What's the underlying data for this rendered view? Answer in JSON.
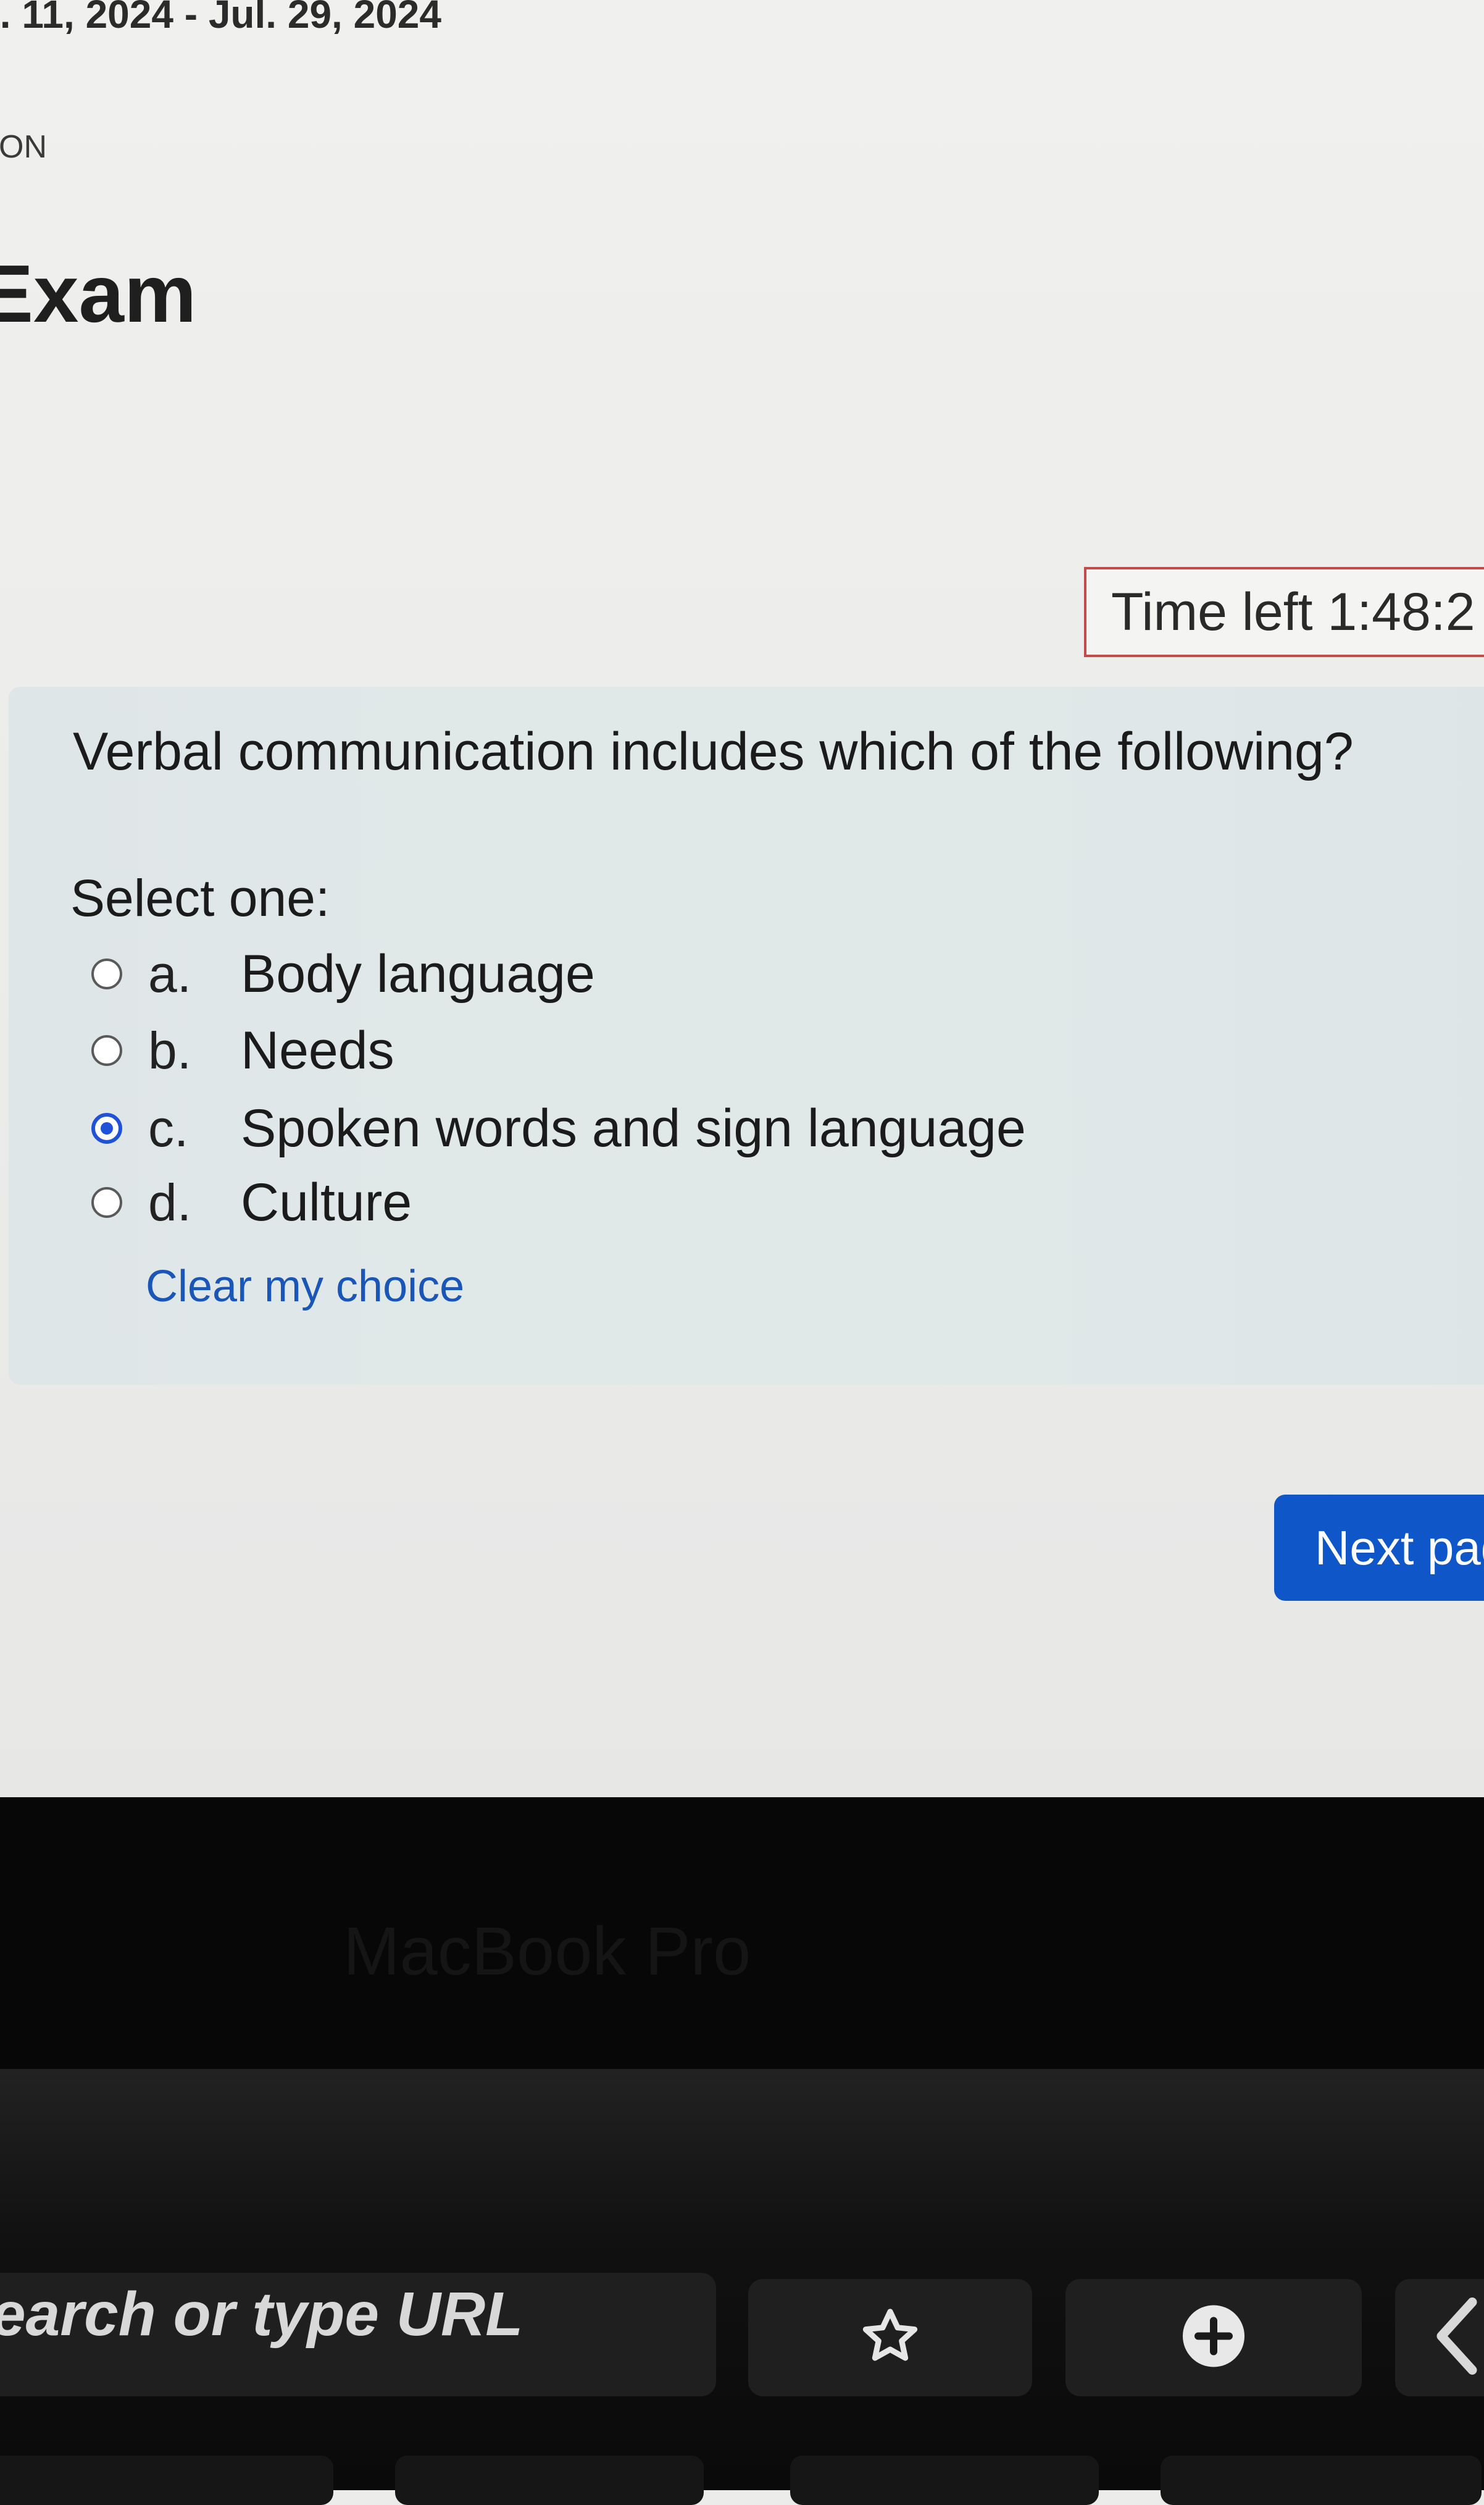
{
  "header": {
    "date_range": "l. 11, 2024 - Jul. 29, 2024",
    "course_tag": "ON",
    "page_title": "Exam"
  },
  "timer": {
    "label": "Time left 1:48:2"
  },
  "question": {
    "text": "Verbal communication includes which of the following?",
    "prompt": "Select one:",
    "options": [
      {
        "letter": "a.",
        "text": "Body language",
        "selected": false
      },
      {
        "letter": "b.",
        "text": "Needs",
        "selected": false
      },
      {
        "letter": "c.",
        "text": "Spoken words and sign language",
        "selected": true
      },
      {
        "letter": "d.",
        "text": "Culture",
        "selected": false
      }
    ],
    "clear_label": "Clear my choice"
  },
  "navigation": {
    "next_label": "Next pag"
  },
  "device": {
    "bezel_label": "MacBook Pro",
    "touchbar": {
      "url_placeholder": "earch or type URL",
      "icons": [
        "star-icon",
        "plus-icon",
        "chevron-left-icon"
      ]
    }
  },
  "colors": {
    "accent": "#0f56c9",
    "radio_selected": "#1f52d8",
    "timer_border": "#c24b4b",
    "link": "#1a55b8"
  }
}
